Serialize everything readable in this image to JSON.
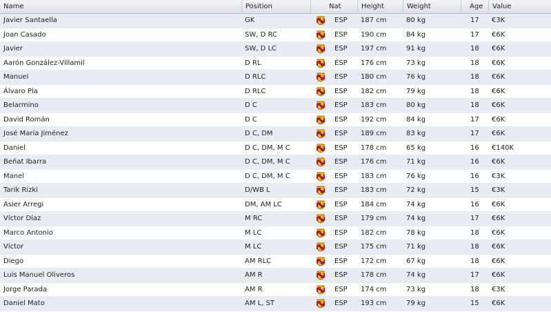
{
  "columns": {
    "name": "Name",
    "position": "Position",
    "nat": "Nat",
    "height": "Height",
    "weight": "Weight",
    "age": "Age",
    "value": "Value"
  },
  "flag_icon": "spain-crest-icon",
  "players": [
    {
      "name": "Javier Santaella",
      "position": "GK",
      "nat": "ESP",
      "height": "187 cm",
      "weight": "80 kg",
      "age": "17",
      "value": "€3K"
    },
    {
      "name": "Joan Casado",
      "position": "SW, D RC",
      "nat": "ESP",
      "height": "190 cm",
      "weight": "84 kg",
      "age": "17",
      "value": "€6K"
    },
    {
      "name": "Javier",
      "position": "SW, D LC",
      "nat": "ESP",
      "height": "197 cm",
      "weight": "91 kg",
      "age": "18",
      "value": "€6K"
    },
    {
      "name": "Aarón González-Villamil",
      "position": "D RL",
      "nat": "ESP",
      "height": "176 cm",
      "weight": "73 kg",
      "age": "18",
      "value": "€6K"
    },
    {
      "name": "Manuel",
      "position": "D RLC",
      "nat": "ESP",
      "height": "180 cm",
      "weight": "76 kg",
      "age": "18",
      "value": "€6K"
    },
    {
      "name": "Álvaro Pla",
      "position": "D RLC",
      "nat": "ESP",
      "height": "182 cm",
      "weight": "79 kg",
      "age": "18",
      "value": "€6K"
    },
    {
      "name": "Belarmino",
      "position": "D C",
      "nat": "ESP",
      "height": "183 cm",
      "weight": "80 kg",
      "age": "18",
      "value": "€6K"
    },
    {
      "name": "David Román",
      "position": "D C",
      "nat": "ESP",
      "height": "192 cm",
      "weight": "84 kg",
      "age": "17",
      "value": "€6K"
    },
    {
      "name": "José María Jiménez",
      "position": "D C, DM",
      "nat": "ESP",
      "height": "189 cm",
      "weight": "83 kg",
      "age": "17",
      "value": "€6K"
    },
    {
      "name": "Daniel",
      "position": "D C, DM, M C",
      "nat": "ESP",
      "height": "178 cm",
      "weight": "65 kg",
      "age": "16",
      "value": "€140K"
    },
    {
      "name": "Beñat Ibarra",
      "position": "D C, DM, M C",
      "nat": "ESP",
      "height": "176 cm",
      "weight": "71 kg",
      "age": "16",
      "value": "€6K"
    },
    {
      "name": "Manel",
      "position": "D C, DM, M C",
      "nat": "ESP",
      "height": "183 cm",
      "weight": "76 kg",
      "age": "16",
      "value": "€3K"
    },
    {
      "name": "Tarik Rizki",
      "position": "D/WB L",
      "nat": "ESP",
      "height": "183 cm",
      "weight": "72 kg",
      "age": "15",
      "value": "€3K"
    },
    {
      "name": "Asier Arregi",
      "position": "DM, AM LC",
      "nat": "ESP",
      "height": "184 cm",
      "weight": "74 kg",
      "age": "16",
      "value": "€6K"
    },
    {
      "name": "Víctor Díaz",
      "position": "M RC",
      "nat": "ESP",
      "height": "179 cm",
      "weight": "74 kg",
      "age": "17",
      "value": "€6K"
    },
    {
      "name": "Marco Antonio",
      "position": "M LC",
      "nat": "ESP",
      "height": "182 cm",
      "weight": "78 kg",
      "age": "18",
      "value": "€6K"
    },
    {
      "name": "Víctor",
      "position": "M LC",
      "nat": "ESP",
      "height": "175 cm",
      "weight": "71 kg",
      "age": "18",
      "value": "€6K"
    },
    {
      "name": "Diego",
      "position": "AM RLC",
      "nat": "ESP",
      "height": "172 cm",
      "weight": "67 kg",
      "age": "18",
      "value": "€6K"
    },
    {
      "name": "Luis Manuel Oliveros",
      "position": "AM R",
      "nat": "ESP",
      "height": "178 cm",
      "weight": "74 kg",
      "age": "17",
      "value": "€6K"
    },
    {
      "name": "Jorge Parada",
      "position": "AM R",
      "nat": "ESP",
      "height": "174 cm",
      "weight": "73 kg",
      "age": "18",
      "value": "€3K"
    },
    {
      "name": "Daniel Mato",
      "position": "AM L, ST",
      "nat": "ESP",
      "height": "193 cm",
      "weight": "79 kg",
      "age": "15",
      "value": "€6K"
    }
  ]
}
